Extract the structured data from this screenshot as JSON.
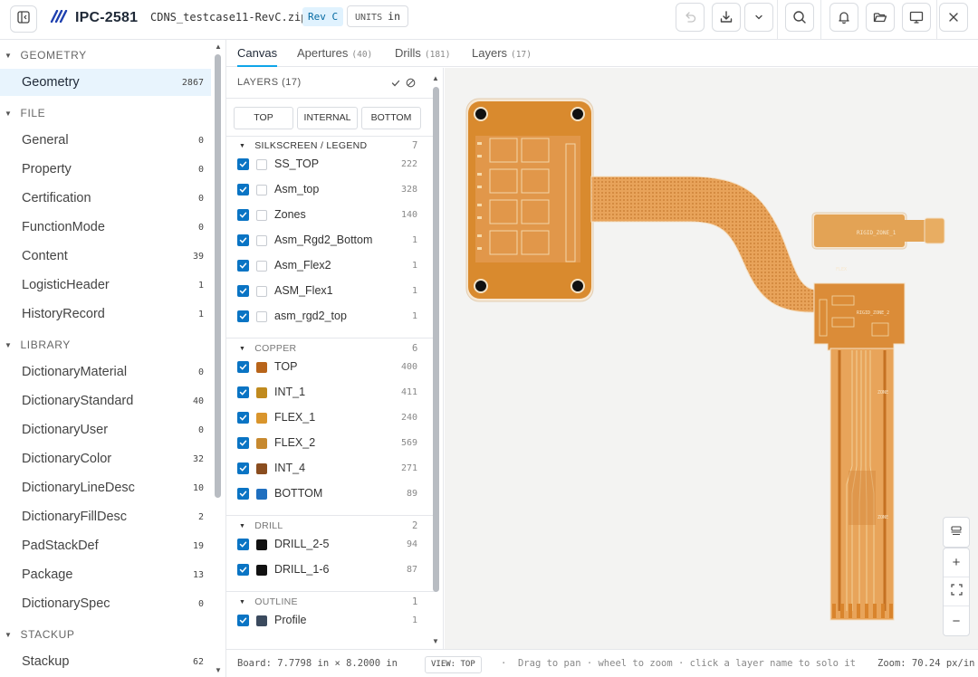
{
  "app": {
    "title": "IPC-2581",
    "filename": "CDNS_testcase11-RevC.zip",
    "revision": "Rev C",
    "units_label": "UNITS",
    "units_value": "in"
  },
  "toolbar": {
    "icons": [
      "sidebar-toggle-icon",
      "undo-icon",
      "download-icon",
      "chevron-down-icon",
      "search-icon",
      "bell-icon",
      "folder-open-icon",
      "monitor-icon",
      "close-icon"
    ]
  },
  "sidebar": {
    "sections": [
      {
        "label": "GEOMETRY"
      },
      {
        "label": "FILE"
      },
      {
        "label": "LIBRARY"
      },
      {
        "label": "STACKUP"
      }
    ],
    "items": [
      {
        "label": "Geometry",
        "count": "2867"
      },
      {
        "label": "General",
        "count": "0"
      },
      {
        "label": "Property",
        "count": "0"
      },
      {
        "label": "Certification",
        "count": "0"
      },
      {
        "label": "FunctionMode",
        "count": "0"
      },
      {
        "label": "Content",
        "count": "39"
      },
      {
        "label": "LogisticHeader",
        "count": "1"
      },
      {
        "label": "HistoryRecord",
        "count": "1"
      },
      {
        "label": "DictionaryMaterial",
        "count": "0"
      },
      {
        "label": "DictionaryStandard",
        "count": "40"
      },
      {
        "label": "DictionaryUser",
        "count": "0"
      },
      {
        "label": "DictionaryColor",
        "count": "32"
      },
      {
        "label": "DictionaryLineDesc",
        "count": "10"
      },
      {
        "label": "DictionaryFillDesc",
        "count": "2"
      },
      {
        "label": "PadStackDef",
        "count": "19"
      },
      {
        "label": "Package",
        "count": "13"
      },
      {
        "label": "DictionarySpec",
        "count": "0"
      },
      {
        "label": "Stackup",
        "count": "62"
      }
    ]
  },
  "tabs": [
    {
      "label": "Canvas",
      "count": ""
    },
    {
      "label": "Apertures",
      "count": "(40)"
    },
    {
      "label": "Drills",
      "count": "(181)"
    },
    {
      "label": "Layers",
      "count": "(17)"
    }
  ],
  "layers_panel": {
    "title": "LAYERS (17)",
    "side_buttons": [
      "TOP",
      "INTERNAL",
      "BOTTOM"
    ],
    "groups": [
      {
        "label": "SILKSCREEN / LEGEND",
        "count": "7",
        "layers": [
          {
            "name": "SS_TOP",
            "count": "222",
            "color": ""
          },
          {
            "name": "Asm_top",
            "count": "328",
            "color": ""
          },
          {
            "name": "Zones",
            "count": "140",
            "color": ""
          },
          {
            "name": "Asm_Rgd2_Bottom",
            "count": "1",
            "color": ""
          },
          {
            "name": "Asm_Flex2",
            "count": "1",
            "color": ""
          },
          {
            "name": "ASM_Flex1",
            "count": "1",
            "color": ""
          },
          {
            "name": "asm_rgd2_top",
            "count": "1",
            "color": ""
          }
        ]
      },
      {
        "label": "COPPER",
        "count": "6",
        "layers": [
          {
            "name": "TOP",
            "count": "400",
            "color": "#b8641a"
          },
          {
            "name": "INT_1",
            "count": "411",
            "color": "#c08a1e"
          },
          {
            "name": "FLEX_1",
            "count": "240",
            "color": "#d9952c"
          },
          {
            "name": "FLEX_2",
            "count": "569",
            "color": "#c7892f"
          },
          {
            "name": "INT_4",
            "count": "271",
            "color": "#8a4d1f"
          },
          {
            "name": "BOTTOM",
            "count": "89",
            "color": "#1f6fbf"
          }
        ]
      },
      {
        "label": "DRILL",
        "count": "2",
        "layers": [
          {
            "name": "DRILL_2-5",
            "count": "94",
            "color": "#111111"
          },
          {
            "name": "DRILL_1-6",
            "count": "87",
            "color": "#111111"
          }
        ]
      },
      {
        "label": "OUTLINE",
        "count": "1",
        "layers": [
          {
            "name": "Profile",
            "count": "1",
            "color": "#3b4a5e"
          }
        ]
      }
    ]
  },
  "canvas": {
    "zone_labels": [
      "RIGID_ZONE_1",
      "RIGID_ZONE_2",
      "ZONE",
      "ZONE",
      "FLEX"
    ],
    "colors": {
      "copper": "#d9952c",
      "copper_dark": "#b8641a",
      "board": "#f3c07a",
      "background": "#f3f3f2"
    }
  },
  "statusbar": {
    "board": "Board: 7.7798 in × 8.2000 in",
    "view": "VIEW: TOP",
    "hint": "Drag to pan · wheel to zoom · click a layer name to solo it",
    "zoom": "Zoom: 70.24 px/in"
  },
  "zoom_controls": {
    "icons": [
      "layers-stack-icon",
      "zoom-in-icon",
      "fit-screen-icon",
      "zoom-out-icon"
    ],
    "labels": [
      "",
      "+",
      "",
      "−"
    ]
  }
}
